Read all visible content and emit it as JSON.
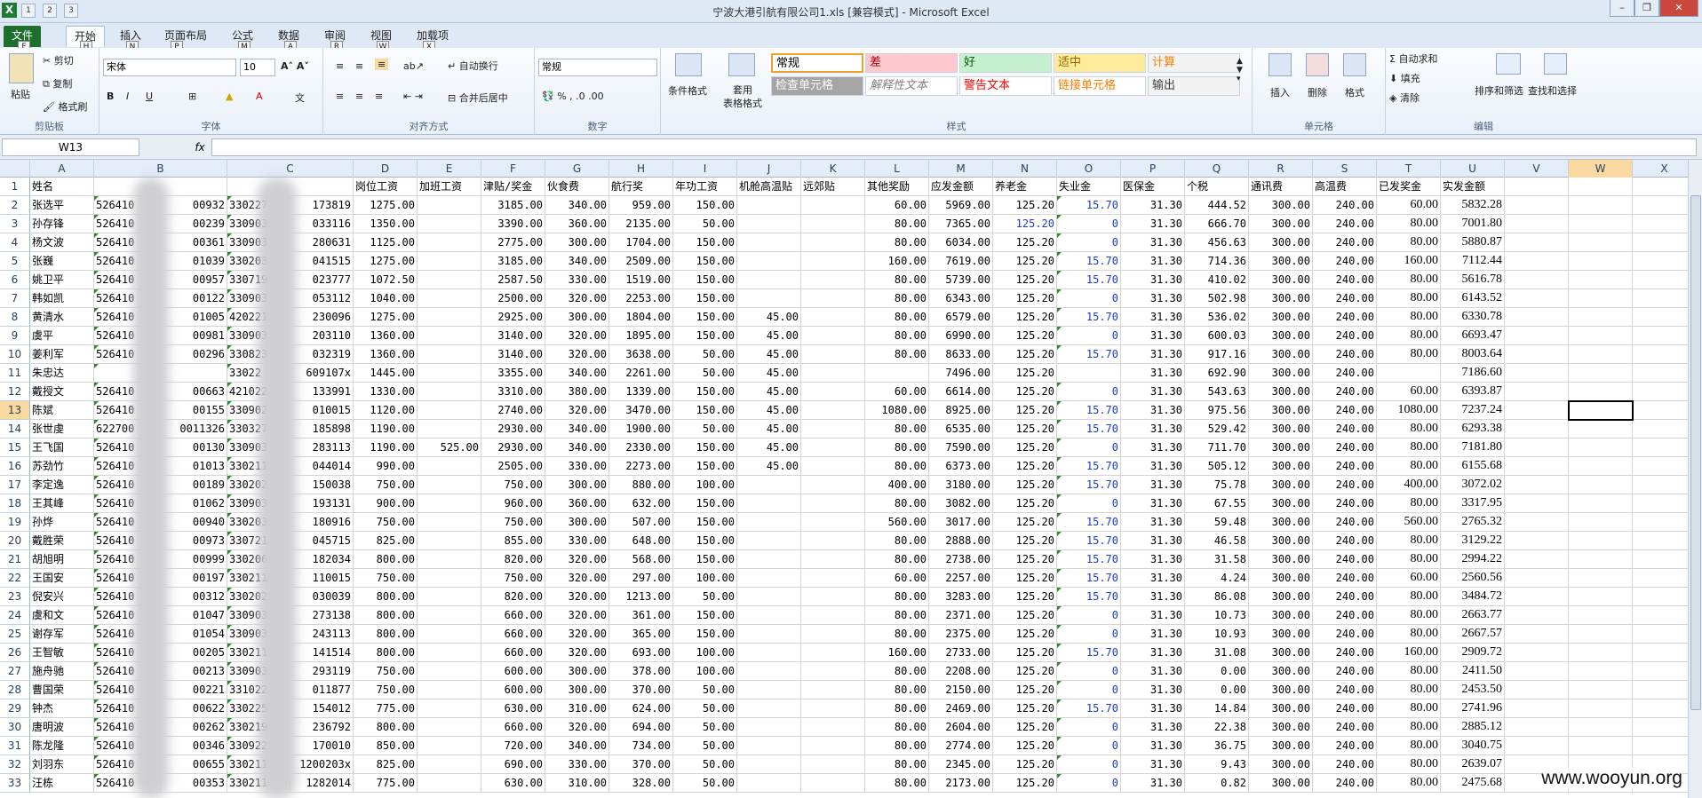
{
  "window": {
    "title": "宁波大港引航有限公司1.xls  [兼容模式]  - Microsoft Excel",
    "logo": "X"
  },
  "qat": {
    "keytips": [
      "1",
      "2",
      "3"
    ]
  },
  "tabs": [
    {
      "label": "文件",
      "key": "F"
    },
    {
      "label": "开始",
      "key": "H"
    },
    {
      "label": "插入",
      "key": "N"
    },
    {
      "label": "页面布局",
      "key": "P"
    },
    {
      "label": "公式",
      "key": "M"
    },
    {
      "label": "数据",
      "key": "A"
    },
    {
      "label": "审阅",
      "key": "R"
    },
    {
      "label": "视图",
      "key": "W"
    },
    {
      "label": "加载项",
      "key": "X"
    }
  ],
  "ribbon": {
    "clipboard": {
      "label": "剪贴板",
      "paste": "粘贴",
      "cut": "剪切",
      "copy": "复制",
      "format_painter": "格式刷"
    },
    "font": {
      "label": "字体",
      "name": "宋体",
      "size": "10"
    },
    "alignment": {
      "label": "对齐方式",
      "wrap": "自动换行",
      "merge": "合并后居中"
    },
    "number": {
      "label": "数字",
      "format": "常规"
    },
    "styles": {
      "label": "样式",
      "cond_format": "条件格式",
      "table_format": "套用\n表格格式",
      "cells": [
        {
          "label": "常规",
          "bg": "#ffffff",
          "fg": "#000000",
          "border": "#f0a030"
        },
        {
          "label": "差",
          "bg": "#ffc7ce",
          "fg": "#9c0006"
        },
        {
          "label": "好",
          "bg": "#c6efce",
          "fg": "#006100"
        },
        {
          "label": "适中",
          "bg": "#ffeb9c",
          "fg": "#9c6500"
        },
        {
          "label": "计算",
          "bg": "#f2f2f2",
          "fg": "#fa7d00"
        },
        {
          "label": "检查单元格",
          "bg": "#a5a5a5",
          "fg": "#ffffff"
        },
        {
          "label": "解释性文本",
          "bg": "#ffffff",
          "fg": "#7f7f7f"
        },
        {
          "label": "警告文本",
          "bg": "#ffffff",
          "fg": "#ff0000"
        },
        {
          "label": "链接单元格",
          "bg": "#ffffff",
          "fg": "#fa7d00"
        },
        {
          "label": "输出",
          "bg": "#f2f2f2",
          "fg": "#3f3f3f"
        }
      ]
    },
    "cells": {
      "label": "单元格",
      "insert": "插入",
      "delete": "删除",
      "format": "格式"
    },
    "editing": {
      "label": "编辑",
      "autosum": "自动求和",
      "fill": "填充",
      "clear": "清除",
      "sort": "排序和筛选",
      "find": "查找和选择"
    }
  },
  "namebox": "W13",
  "fx": "fx",
  "columns": [
    "A",
    "B",
    "C",
    "D",
    "E",
    "F",
    "G",
    "H",
    "I",
    "J",
    "K",
    "L",
    "M",
    "N",
    "O",
    "P",
    "Q",
    "R",
    "S",
    "T",
    "U",
    "V",
    "W",
    "X"
  ],
  "header_row": [
    "姓名",
    "",
    "",
    "岗位工资",
    "加班工资",
    "津贴/奖金",
    "伙食费",
    "航行奖",
    "年功工资",
    "机舱高温贴",
    "远郊贴",
    "其他奖励",
    "应发金额",
    "养老金",
    "失业金",
    "医保金",
    "个税",
    "通讯费",
    "高温费",
    "已发奖金",
    "实发金额",
    "",
    "",
    ""
  ],
  "rows": [
    [
      "张选平",
      "526410",
      "00932",
      "330227",
      "173819",
      "1275.00",
      "",
      "3185.00",
      "340.00",
      "959.00",
      "150.00",
      "",
      "",
      "60.00",
      "5969.00",
      "125.20",
      "15.70",
      "31.30",
      "444.52",
      "300.00",
      "240.00",
      "60.00",
      "5832.28"
    ],
    [
      "孙存锋",
      "526410",
      "00239",
      "330903",
      "033116",
      "1350.00",
      "",
      "3390.00",
      "360.00",
      "2135.00",
      "50.00",
      "",
      "",
      "80.00",
      "7365.00",
      "125.20",
      "0",
      "31.30",
      "666.70",
      "300.00",
      "240.00",
      "80.00",
      "7001.80"
    ],
    [
      "杨文波",
      "526410",
      "00361",
      "330903",
      "280631",
      "1125.00",
      "",
      "2775.00",
      "300.00",
      "1704.00",
      "150.00",
      "",
      "",
      "80.00",
      "6034.00",
      "125.20",
      "0",
      "31.30",
      "456.63",
      "300.00",
      "240.00",
      "80.00",
      "5880.87"
    ],
    [
      "张巍",
      "526410",
      "01039",
      "330203",
      "041515",
      "1275.00",
      "",
      "3185.00",
      "340.00",
      "2509.00",
      "150.00",
      "",
      "",
      "160.00",
      "7619.00",
      "125.20",
      "15.70",
      "31.30",
      "714.36",
      "300.00",
      "240.00",
      "160.00",
      "7112.44"
    ],
    [
      "姚卫平",
      "526410",
      "00957",
      "330719",
      "023777",
      "1072.50",
      "",
      "2587.50",
      "330.00",
      "1519.00",
      "150.00",
      "",
      "",
      "80.00",
      "5739.00",
      "125.20",
      "15.70",
      "31.30",
      "410.02",
      "300.00",
      "240.00",
      "80.00",
      "5616.78"
    ],
    [
      "韩如凯",
      "526410",
      "00122",
      "330903",
      "053112",
      "1040.00",
      "",
      "2500.00",
      "320.00",
      "2253.00",
      "150.00",
      "",
      "",
      "80.00",
      "6343.00",
      "125.20",
      "0",
      "31.30",
      "502.98",
      "300.00",
      "240.00",
      "80.00",
      "6143.52"
    ],
    [
      "黄清水",
      "526410",
      "01005",
      "420221",
      "230096",
      "1275.00",
      "",
      "2925.00",
      "300.00",
      "1804.00",
      "150.00",
      "45.00",
      "",
      "80.00",
      "6579.00",
      "125.20",
      "15.70",
      "31.30",
      "536.02",
      "300.00",
      "240.00",
      "80.00",
      "6330.78"
    ],
    [
      "虞平",
      "526410",
      "00981",
      "330903",
      "203110",
      "1360.00",
      "",
      "3140.00",
      "320.00",
      "1895.00",
      "150.00",
      "45.00",
      "",
      "80.00",
      "6990.00",
      "125.20",
      "0",
      "31.30",
      "600.03",
      "300.00",
      "240.00",
      "80.00",
      "6693.47"
    ],
    [
      "姜利军",
      "526410",
      "00296",
      "330823",
      "032319",
      "1360.00",
      "",
      "3140.00",
      "320.00",
      "3638.00",
      "50.00",
      "45.00",
      "",
      "80.00",
      "8633.00",
      "125.20",
      "15.70",
      "31.30",
      "917.16",
      "300.00",
      "240.00",
      "80.00",
      "8003.64"
    ],
    [
      "朱忠达",
      "",
      "",
      "33022",
      "609107x",
      "1445.00",
      "",
      "3355.00",
      "340.00",
      "2261.00",
      "50.00",
      "45.00",
      "",
      "",
      "7496.00",
      "125.20",
      "",
      "31.30",
      "692.90",
      "300.00",
      "240.00",
      "",
      "7186.60"
    ],
    [
      "戴授文",
      "526410",
      "00663",
      "421022",
      "133991",
      "1330.00",
      "",
      "3310.00",
      "380.00",
      "1339.00",
      "150.00",
      "45.00",
      "",
      "60.00",
      "6614.00",
      "125.20",
      "0",
      "31.30",
      "543.63",
      "300.00",
      "240.00",
      "60.00",
      "6393.87"
    ],
    [
      "陈斌",
      "526410",
      "00155",
      "330902",
      "010015",
      "1120.00",
      "",
      "2740.00",
      "320.00",
      "3470.00",
      "150.00",
      "45.00",
      "",
      "1080.00",
      "8925.00",
      "125.20",
      "15.70",
      "31.30",
      "975.56",
      "300.00",
      "240.00",
      "1080.00",
      "7237.24"
    ],
    [
      "张世虔",
      "622700",
      "0011326",
      "330327",
      "185898",
      "1190.00",
      "",
      "2930.00",
      "340.00",
      "1900.00",
      "50.00",
      "45.00",
      "",
      "80.00",
      "6535.00",
      "125.20",
      "15.70",
      "31.30",
      "529.42",
      "300.00",
      "240.00",
      "80.00",
      "6293.38"
    ],
    [
      "王飞国",
      "526410",
      "00130",
      "330903",
      "283113",
      "1190.00",
      "525.00",
      "2930.00",
      "340.00",
      "2330.00",
      "150.00",
      "45.00",
      "",
      "80.00",
      "7590.00",
      "125.20",
      "0",
      "31.30",
      "711.70",
      "300.00",
      "240.00",
      "80.00",
      "7181.80"
    ],
    [
      "苏劲竹",
      "526410",
      "01013",
      "330211",
      "044014",
      "990.00",
      "",
      "2505.00",
      "330.00",
      "2273.00",
      "150.00",
      "45.00",
      "",
      "80.00",
      "6373.00",
      "125.20",
      "15.70",
      "31.30",
      "505.12",
      "300.00",
      "240.00",
      "80.00",
      "6155.68"
    ],
    [
      "李定逸",
      "526410",
      "00189",
      "330202",
      "150038",
      "750.00",
      "",
      "750.00",
      "300.00",
      "880.00",
      "100.00",
      "",
      "",
      "400.00",
      "3180.00",
      "125.20",
      "15.70",
      "31.30",
      "75.78",
      "300.00",
      "240.00",
      "400.00",
      "3072.02"
    ],
    [
      "王其峰",
      "526410",
      "01062",
      "330903",
      "193131",
      "900.00",
      "",
      "960.00",
      "360.00",
      "632.00",
      "150.00",
      "",
      "",
      "80.00",
      "3082.00",
      "125.20",
      "0",
      "31.30",
      "67.55",
      "300.00",
      "240.00",
      "80.00",
      "3317.95"
    ],
    [
      "孙烨",
      "526410",
      "00940",
      "330203",
      "180916",
      "750.00",
      "",
      "750.00",
      "300.00",
      "507.00",
      "150.00",
      "",
      "",
      "560.00",
      "3017.00",
      "125.20",
      "15.70",
      "31.30",
      "59.48",
      "300.00",
      "240.00",
      "560.00",
      "2765.32"
    ],
    [
      "戴胜荣",
      "526410",
      "00973",
      "330721",
      "045715",
      "825.00",
      "",
      "855.00",
      "330.00",
      "648.00",
      "150.00",
      "",
      "",
      "80.00",
      "2888.00",
      "125.20",
      "15.70",
      "31.30",
      "46.58",
      "300.00",
      "240.00",
      "80.00",
      "3129.22"
    ],
    [
      "胡旭明",
      "526410",
      "00999",
      "330206",
      "182034",
      "800.00",
      "",
      "820.00",
      "320.00",
      "568.00",
      "150.00",
      "",
      "",
      "80.00",
      "2738.00",
      "125.20",
      "15.70",
      "31.30",
      "31.58",
      "300.00",
      "240.00",
      "80.00",
      "2994.22"
    ],
    [
      "王国安",
      "526410",
      "00197",
      "330211",
      "110015",
      "750.00",
      "",
      "750.00",
      "320.00",
      "297.00",
      "100.00",
      "",
      "",
      "60.00",
      "2257.00",
      "125.20",
      "15.70",
      "31.30",
      "4.24",
      "300.00",
      "240.00",
      "60.00",
      "2560.56"
    ],
    [
      "倪安兴",
      "526410",
      "00312",
      "330202",
      "030039",
      "800.00",
      "",
      "820.00",
      "320.00",
      "1213.00",
      "50.00",
      "",
      "",
      "80.00",
      "3283.00",
      "125.20",
      "15.70",
      "31.30",
      "86.08",
      "300.00",
      "240.00",
      "80.00",
      "3484.72"
    ],
    [
      "虞和文",
      "526410",
      "01047",
      "330903",
      "273138",
      "800.00",
      "",
      "660.00",
      "320.00",
      "361.00",
      "150.00",
      "",
      "",
      "80.00",
      "2371.00",
      "125.20",
      "0",
      "31.30",
      "10.73",
      "300.00",
      "240.00",
      "80.00",
      "2663.77"
    ],
    [
      "谢存军",
      "526410",
      "01054",
      "330903",
      "243113",
      "800.00",
      "",
      "660.00",
      "320.00",
      "365.00",
      "150.00",
      "",
      "",
      "80.00",
      "2375.00",
      "125.20",
      "0",
      "31.30",
      "10.93",
      "300.00",
      "240.00",
      "80.00",
      "2667.57"
    ],
    [
      "王智敏",
      "526410",
      "00205",
      "330211",
      "141514",
      "800.00",
      "",
      "660.00",
      "320.00",
      "693.00",
      "100.00",
      "",
      "",
      "160.00",
      "2733.00",
      "125.20",
      "15.70",
      "31.30",
      "31.08",
      "300.00",
      "240.00",
      "160.00",
      "2909.72"
    ],
    [
      "施舟驰",
      "526410",
      "00213",
      "330903",
      "293119",
      "750.00",
      "",
      "600.00",
      "300.00",
      "378.00",
      "100.00",
      "",
      "",
      "80.00",
      "2208.00",
      "125.20",
      "0",
      "31.30",
      "0.00",
      "300.00",
      "240.00",
      "80.00",
      "2411.50"
    ],
    [
      "曹国荣",
      "526410",
      "00221",
      "331022",
      "011877",
      "750.00",
      "",
      "600.00",
      "300.00",
      "370.00",
      "50.00",
      "",
      "",
      "80.00",
      "2150.00",
      "125.20",
      "0",
      "31.30",
      "0.00",
      "300.00",
      "240.00",
      "80.00",
      "2453.50"
    ],
    [
      "钟杰",
      "526410",
      "00622",
      "330225",
      "154012",
      "775.00",
      "",
      "630.00",
      "310.00",
      "624.00",
      "50.00",
      "",
      "",
      "80.00",
      "2469.00",
      "125.20",
      "15.70",
      "31.30",
      "14.84",
      "300.00",
      "240.00",
      "80.00",
      "2741.96"
    ],
    [
      "唐明波",
      "526410",
      "00262",
      "330219",
      "236792",
      "800.00",
      "",
      "660.00",
      "320.00",
      "694.00",
      "50.00",
      "",
      "",
      "80.00",
      "2604.00",
      "125.20",
      "0",
      "31.30",
      "22.38",
      "300.00",
      "240.00",
      "80.00",
      "2885.12"
    ],
    [
      "陈龙隆",
      "526410",
      "00346",
      "330922",
      "170010",
      "850.00",
      "",
      "720.00",
      "340.00",
      "734.00",
      "50.00",
      "",
      "",
      "80.00",
      "2774.00",
      "125.20",
      "0",
      "31.30",
      "36.75",
      "300.00",
      "240.00",
      "80.00",
      "3040.75"
    ],
    [
      "刘羽东",
      "526410",
      "00655",
      "330211",
      "1200203x",
      "825.00",
      "",
      "690.00",
      "330.00",
      "370.00",
      "50.00",
      "",
      "",
      "80.00",
      "2345.00",
      "125.20",
      "0",
      "31.30",
      "9.43",
      "300.00",
      "240.00",
      "80.00",
      "2639.07"
    ],
    [
      "汪栋",
      "526410",
      "00353",
      "330211",
      "1282014",
      "775.00",
      "",
      "630.00",
      "310.00",
      "328.00",
      "50.00",
      "",
      "",
      "80.00",
      "2173.00",
      "125.20",
      "0",
      "31.30",
      "0.82",
      "300.00",
      "240.00",
      "80.00",
      "2475.68"
    ]
  ],
  "watermark": "www.wooyun.org"
}
